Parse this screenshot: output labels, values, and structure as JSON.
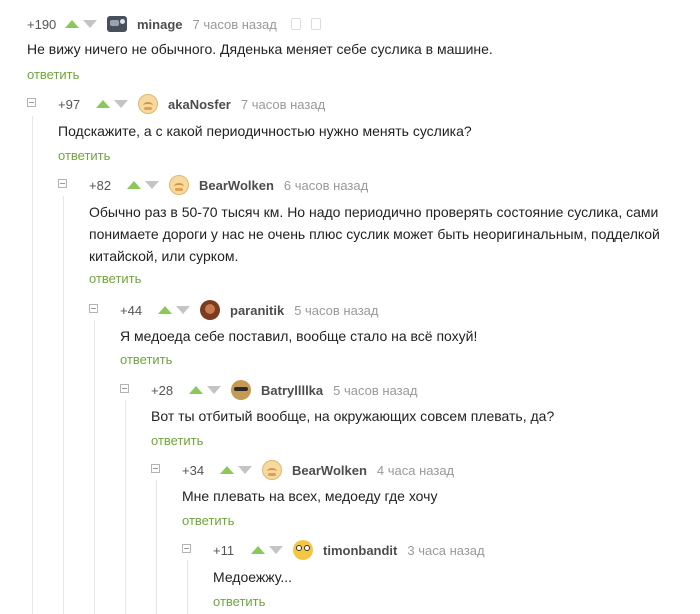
{
  "reply_label": "ответить",
  "colors": {
    "upvote": "#8ac858",
    "downvote": "#c4c4c4",
    "reply_link": "#6fa53b",
    "meta": "#999999"
  },
  "comments": [
    {
      "rating": "+190",
      "author": "minage",
      "avatar_icon": "user-avatar-icon",
      "time": "7 часов назад",
      "text": "Не вижу ничего не обычного. Дяденька меняет себе суслика в машине."
    },
    {
      "rating": "+97",
      "author": "akaNosfer",
      "avatar_icon": "smiley-avatar-icon",
      "time": "7 часов назад",
      "text": "Подскажите, а с какой периодичностью нужно менять суслика?"
    },
    {
      "rating": "+82",
      "author": "BearWolken",
      "avatar_icon": "smiley-avatar-icon",
      "time": "6 часов назад",
      "text_lines": [
        "Обычно раз в 50-70 тысяч км. Но надо периодично проверять состояние суслика, сами",
        "понимаете дороги у нас не очень плюс суслик может быть неоригинальным, подделкой",
        "китайской, или сурком."
      ]
    },
    {
      "rating": "+44",
      "author": "paranitik",
      "avatar_icon": "user-avatar-icon",
      "time": "5 часов назад",
      "text": "Я медоеда себе поставил, вообще стало на всё похуй!"
    },
    {
      "rating": "+28",
      "author": "Batryllllka",
      "avatar_icon": "sunglasses-avatar-icon",
      "time": "5 часов назад",
      "text": "Вот ты отбитый вообще, на окружающих совсем плевать, да?"
    },
    {
      "rating": "+34",
      "author": "BearWolken",
      "avatar_icon": "smiley-avatar-icon",
      "time": "4 часа назад",
      "text": "Мне плевать на всех, медоеду где хочу"
    },
    {
      "rating": "+11",
      "author": "timonbandit",
      "avatar_icon": "cartoon-avatar-icon",
      "time": "3 часа назад",
      "text": "Медоежжу..."
    }
  ]
}
